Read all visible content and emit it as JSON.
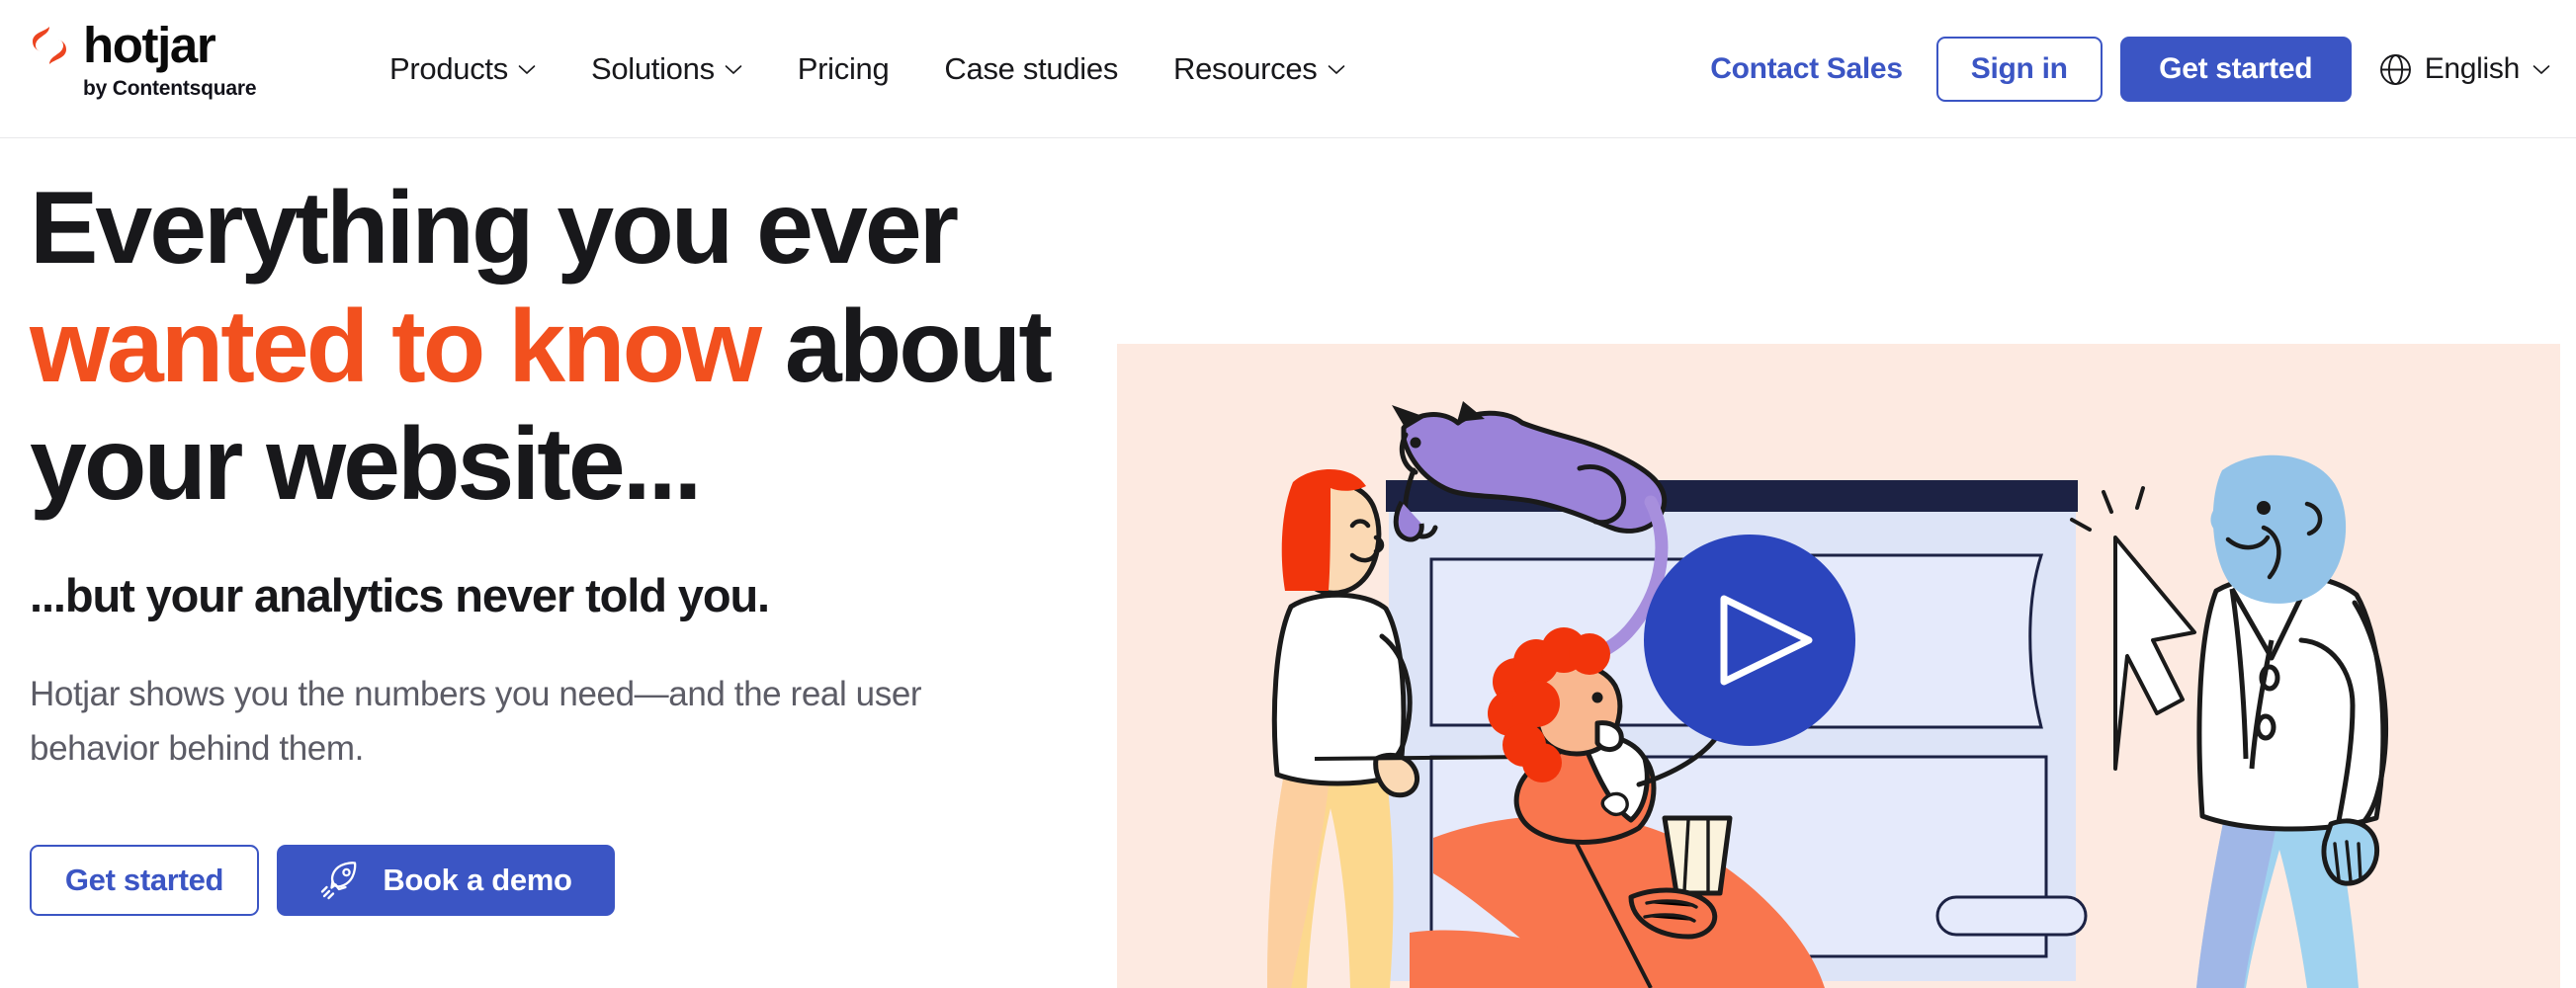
{
  "brand": {
    "name": "hotjar",
    "tagline": "by Contentsquare",
    "logo_icon": "hotjar-flame-mark",
    "logo_color": "#ec4420"
  },
  "header": {
    "nav": [
      {
        "label": "Products",
        "has_dropdown": true,
        "icon": "chevron-down-icon"
      },
      {
        "label": "Solutions",
        "has_dropdown": true,
        "icon": "chevron-down-icon"
      },
      {
        "label": "Pricing",
        "has_dropdown": false,
        "icon": ""
      },
      {
        "label": "Case studies",
        "has_dropdown": false,
        "icon": ""
      },
      {
        "label": "Resources",
        "has_dropdown": true,
        "icon": "chevron-down-icon"
      }
    ],
    "contact_sales": "Contact Sales",
    "sign_in": "Sign in",
    "get_started": "Get started",
    "language": {
      "label": "English",
      "icon": "globe-icon",
      "chevron": "chevron-down-icon"
    }
  },
  "hero": {
    "headline_part1": "Everything you ever ",
    "headline_accent": "wanted to know",
    "headline_part2": " about your website...",
    "subheadline": "...but your analytics never told you.",
    "lede": "Hotjar shows you the numbers you need—and the real user behavior behind them.",
    "cta_primary": "Get started",
    "cta_secondary": "Book a demo",
    "cta_secondary_icon": "rocket-icon",
    "illustration": {
      "alt": "Illustration of people around a browser window with a play button, a purple cat on top, a woman with red hair in a white top and yellow trousers, a seated man with orange curly hair holding a drink, and a blue-skinned man in a white coat",
      "background_color": "#fdeae1",
      "play_button_icon": "play-icon"
    }
  },
  "colors": {
    "brand_blue": "#3b55c4",
    "brand_orange": "#f2501e",
    "logo_red": "#ec4420",
    "text_dark": "#18181b",
    "text_muted": "#5c5c66",
    "hero_bg": "#fdeae1",
    "browser_bg": "#dde4f7",
    "browser_titlebar": "#1c2244",
    "cat_purple": "#9b83d9",
    "skin_blue": "#93c3e8"
  }
}
